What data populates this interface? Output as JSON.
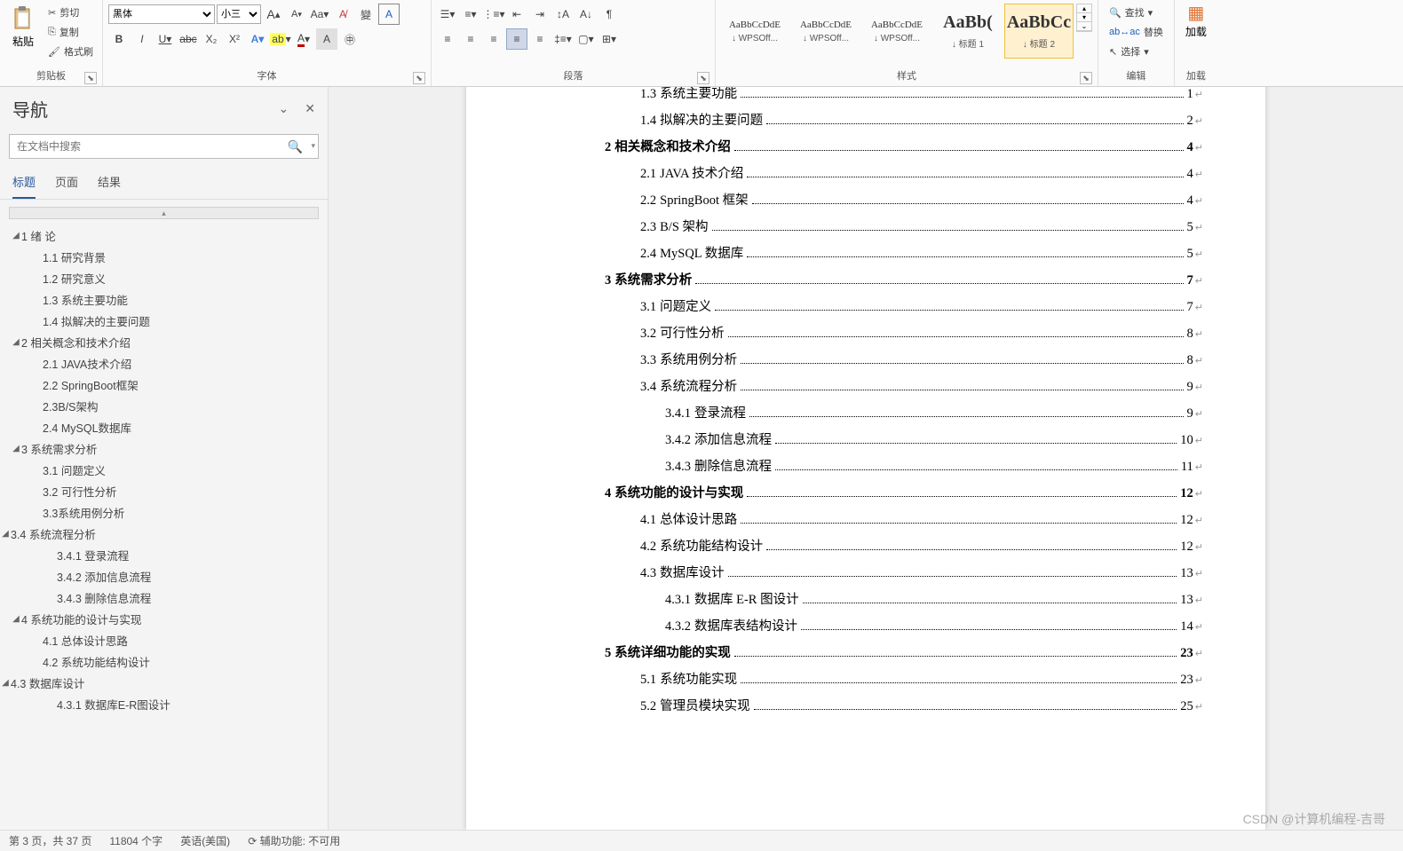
{
  "ribbon": {
    "clipboard": {
      "label": "剪贴板",
      "paste": "粘贴",
      "cut": "剪切",
      "copy": "复制",
      "painter": "格式刷"
    },
    "font": {
      "label": "字体",
      "name": "黑体",
      "size": "小三",
      "bold": "B",
      "italic": "I",
      "underline": "U",
      "strike": "abc",
      "sub": "X₂",
      "sup": "X²",
      "grow": "A",
      "shrink": "A",
      "case": "Aa",
      "clear": "A",
      "phonetic": "變",
      "border": "A",
      "highlight": "ab",
      "color": "A"
    },
    "paragraph": {
      "label": "段落"
    },
    "styles": {
      "label": "样式",
      "items": [
        {
          "preview": "AaBbCcDdE",
          "name": "↓ WPSOff...",
          "big": false
        },
        {
          "preview": "AaBbCcDdE",
          "name": "↓ WPSOff...",
          "big": false
        },
        {
          "preview": "AaBbCcDdE",
          "name": "↓ WPSOff...",
          "big": false
        },
        {
          "preview": "AaBb(",
          "name": "↓ 标题 1",
          "big": true
        },
        {
          "preview": "AaBbCc",
          "name": "↓ 标题 2",
          "big": true
        }
      ]
    },
    "editing": {
      "label": "编辑",
      "find": "查找",
      "replace": "替换",
      "select": "选择"
    },
    "addin": "加载"
  },
  "nav": {
    "title": "导航",
    "search_placeholder": "在文档中搜索",
    "tabs": {
      "headings": "标题",
      "pages": "页面",
      "results": "结果"
    },
    "tree": [
      {
        "lvl": 1,
        "caret": true,
        "text": "1 绪  论"
      },
      {
        "lvl": 2,
        "text": "1.1 研究背景"
      },
      {
        "lvl": 2,
        "text": "1.2 研究意义"
      },
      {
        "lvl": 2,
        "text": "1.3 系统主要功能"
      },
      {
        "lvl": 2,
        "text": "1.4 拟解决的主要问题"
      },
      {
        "lvl": 1,
        "caret": true,
        "text": "2 相关概念和技术介绍"
      },
      {
        "lvl": 2,
        "text": "2.1 JAVA技术介绍"
      },
      {
        "lvl": 2,
        "text": "2.2 SpringBoot框架"
      },
      {
        "lvl": 2,
        "text": "2.3B/S架构"
      },
      {
        "lvl": 2,
        "text": "2.4 MySQL数据库"
      },
      {
        "lvl": 1,
        "caret": true,
        "text": "3 系统需求分析"
      },
      {
        "lvl": 2,
        "text": "3.1 问题定义"
      },
      {
        "lvl": 2,
        "text": "3.2 可行性分析"
      },
      {
        "lvl": 2,
        "text": "3.3系统用例分析"
      },
      {
        "lvl": 2,
        "caret": true,
        "clvl": "2c",
        "text": "3.4 系统流程分析"
      },
      {
        "lvl": 3,
        "text": "3.4.1 登录流程"
      },
      {
        "lvl": 3,
        "text": "3.4.2 添加信息流程"
      },
      {
        "lvl": 3,
        "text": "3.4.3 删除信息流程"
      },
      {
        "lvl": 1,
        "caret": true,
        "text": "4 系统功能的设计与实现"
      },
      {
        "lvl": 2,
        "text": "4.1 总体设计思路"
      },
      {
        "lvl": 2,
        "text": "4.2 系统功能结构设计"
      },
      {
        "lvl": 2,
        "caret": true,
        "clvl": "2c",
        "text": "4.3 数据库设计"
      },
      {
        "lvl": 3,
        "text": "4.3.1 数据库E-R图设计"
      }
    ]
  },
  "toc": [
    {
      "ind": 2,
      "num": "1.3",
      "text": "系统主要功能",
      "page": "1",
      "bold": false
    },
    {
      "ind": 2,
      "num": "1.4",
      "text": "拟解决的主要问题",
      "page": "2",
      "bold": false
    },
    {
      "ind": 1,
      "num": "2",
      "text": "相关概念和技术介绍",
      "page": "4",
      "bold": true
    },
    {
      "ind": 2,
      "num": "2.1",
      "text": "JAVA 技术介绍",
      "page": "4",
      "bold": false
    },
    {
      "ind": 2,
      "num": "2.2",
      "text": "SpringBoot 框架",
      "page": "4",
      "bold": false
    },
    {
      "ind": 2,
      "num": "2.3",
      "text": "B/S 架构",
      "page": "5",
      "bold": false,
      "nosp": true
    },
    {
      "ind": 2,
      "num": "2.4",
      "text": "MySQL 数据库",
      "page": "5",
      "bold": false,
      "nosp": true
    },
    {
      "ind": 1,
      "num": "3",
      "text": "系统需求分析",
      "page": "7",
      "bold": true
    },
    {
      "ind": 2,
      "num": "3.1",
      "text": "问题定义",
      "page": "7",
      "bold": false
    },
    {
      "ind": 2,
      "num": "3.2",
      "text": "可行性分析",
      "page": "8",
      "bold": false
    },
    {
      "ind": 2,
      "num": "3.3",
      "text": "系统用例分析",
      "page": "8",
      "bold": false
    },
    {
      "ind": 2,
      "num": "3.4",
      "text": "系统流程分析",
      "page": "9",
      "bold": false
    },
    {
      "ind": 3,
      "num": "3.4.1",
      "text": "登录流程",
      "page": "9",
      "bold": false
    },
    {
      "ind": 3,
      "num": "3.4.2",
      "text": "添加信息流程",
      "page": "10",
      "bold": false
    },
    {
      "ind": 3,
      "num": "3.4.3",
      "text": "删除信息流程",
      "page": "11",
      "bold": false
    },
    {
      "ind": 1,
      "num": "4",
      "text": "系统功能的设计与实现",
      "page": "12",
      "bold": true
    },
    {
      "ind": 2,
      "num": "4.1",
      "text": "总体设计思路",
      "page": "12",
      "bold": false
    },
    {
      "ind": 2,
      "num": "4.2",
      "text": "系统功能结构设计",
      "page": "12",
      "bold": false
    },
    {
      "ind": 2,
      "num": "4.3",
      "text": "数据库设计",
      "page": "13",
      "bold": false
    },
    {
      "ind": 3,
      "num": "4.3.1",
      "text": "数据库 E-R 图设计",
      "page": "13",
      "bold": false
    },
    {
      "ind": 3,
      "num": "4.3.2",
      "text": "数据库表结构设计",
      "page": "14",
      "bold": false
    },
    {
      "ind": 1,
      "num": "5",
      "text": "系统详细功能的实现",
      "page": "23",
      "bold": true
    },
    {
      "ind": 2,
      "num": "5.1",
      "text": "系统功能实现",
      "page": "23",
      "bold": false
    },
    {
      "ind": 2,
      "num": "5.2",
      "text": "管理员模块实现",
      "page": "25",
      "bold": false
    }
  ],
  "status": {
    "page": "第 3 页，共 37 页",
    "words": "11804 个字",
    "lang": "英语(美国)",
    "a11y": "辅助功能: 不可用"
  },
  "watermark": "CSDN @计算机编程-吉哥"
}
